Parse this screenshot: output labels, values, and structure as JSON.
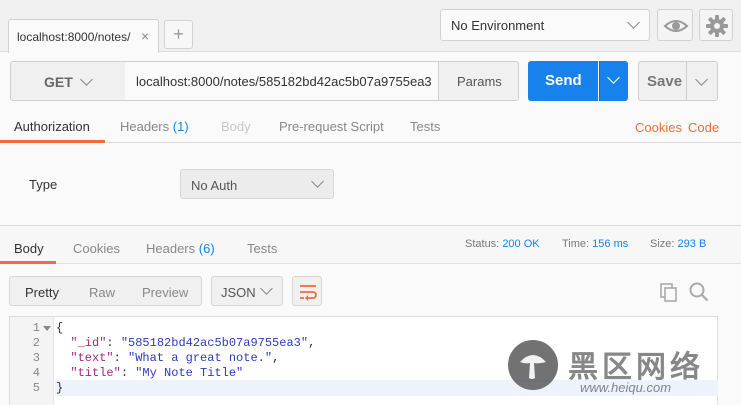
{
  "tabs": [
    {
      "label": "localhost:8000/notes/",
      "close": "×"
    }
  ],
  "tab_add": "+",
  "environment": {
    "selected": "No Environment"
  },
  "request": {
    "method": "GET",
    "url": "localhost:8000/notes/585182bd42ac5b07a9755ea3",
    "params_label": "Params",
    "send_label": "Send",
    "save_label": "Save"
  },
  "request_tabs": {
    "authorization": "Authorization",
    "headers": "Headers",
    "headers_count": "(1)",
    "body": "Body",
    "prerequest": "Pre-request Script",
    "tests": "Tests",
    "cookies_link": "Cookies",
    "code_link": "Code"
  },
  "auth": {
    "type_label": "Type",
    "selected": "No Auth"
  },
  "response_tabs": {
    "body": "Body",
    "cookies": "Cookies",
    "headers": "Headers",
    "headers_count": "(6)",
    "tests": "Tests"
  },
  "response_meta": {
    "status_label": "Status:",
    "status_value": "200 OK",
    "time_label": "Time:",
    "time_value": "156 ms",
    "size_label": "Size:",
    "size_value": "293 B"
  },
  "view_modes": {
    "pretty": "Pretty",
    "raw": "Raw",
    "preview": "Preview"
  },
  "format": {
    "selected": "JSON"
  },
  "code_lines": [
    {
      "num": "1",
      "parts": [
        {
          "t": "{",
          "c": "p"
        }
      ]
    },
    {
      "num": "2",
      "parts": [
        {
          "t": "  ",
          "c": "p"
        },
        {
          "t": "\"_id\"",
          "c": "k"
        },
        {
          "t": ": ",
          "c": "p"
        },
        {
          "t": "\"585182bd42ac5b07a9755ea3\"",
          "c": "s"
        },
        {
          "t": ",",
          "c": "p"
        }
      ]
    },
    {
      "num": "3",
      "parts": [
        {
          "t": "  ",
          "c": "p"
        },
        {
          "t": "\"text\"",
          "c": "k"
        },
        {
          "t": ": ",
          "c": "p"
        },
        {
          "t": "\"What a great note.\"",
          "c": "s"
        },
        {
          "t": ",",
          "c": "p"
        }
      ]
    },
    {
      "num": "4",
      "parts": [
        {
          "t": "  ",
          "c": "p"
        },
        {
          "t": "\"title\"",
          "c": "k"
        },
        {
          "t": ": ",
          "c": "p"
        },
        {
          "t": "\"My Note Title\"",
          "c": "s"
        }
      ]
    },
    {
      "num": "5",
      "parts": [
        {
          "t": "}",
          "c": "p"
        }
      ]
    }
  ],
  "watermark": {
    "title": "黑区网络",
    "url": "www.heiqu.com"
  }
}
